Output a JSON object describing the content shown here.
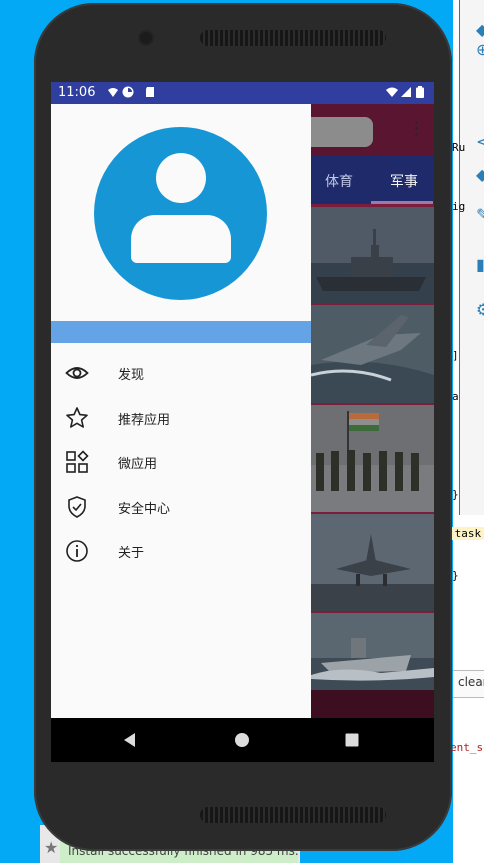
{
  "ide": {
    "code_lines": [
      {
        "text": "Ru"
      },
      {
        "text": "ig"
      },
      {
        "text": "]"
      },
      {
        "text": "a"
      },
      {
        "text": "}"
      },
      {
        "text": ":task"
      },
      {
        "text": "}"
      },
      {
        "text": "ent_so"
      }
    ],
    "clear_label": "clear",
    "status_message": "Install successfully finished in 985 ms."
  },
  "status_bar": {
    "time": "11:06",
    "bg_color": "#303f9f"
  },
  "app": {
    "tabs": [
      {
        "label": "体育",
        "active": false
      },
      {
        "label": "军事",
        "active": true
      }
    ],
    "thumbnails": [
      {
        "name": "warship-image"
      },
      {
        "name": "fighter-jet-image"
      },
      {
        "name": "soldiers-flag-image"
      },
      {
        "name": "jet-takeoff-image"
      },
      {
        "name": "navy-boat-image"
      }
    ]
  },
  "drawer": {
    "avatar_color": "#1796d6",
    "strip_color": "#64a3e6",
    "menu": [
      {
        "label": "发现",
        "icon": "eye-icon"
      },
      {
        "label": "推荐应用",
        "icon": "star-icon"
      },
      {
        "label": "微应用",
        "icon": "apps-grid-icon"
      },
      {
        "label": "安全中心",
        "icon": "shield-check-icon"
      },
      {
        "label": "关于",
        "icon": "info-icon"
      }
    ]
  },
  "nav_bar": {
    "buttons": [
      "back-icon",
      "home-icon",
      "recents-icon"
    ]
  }
}
